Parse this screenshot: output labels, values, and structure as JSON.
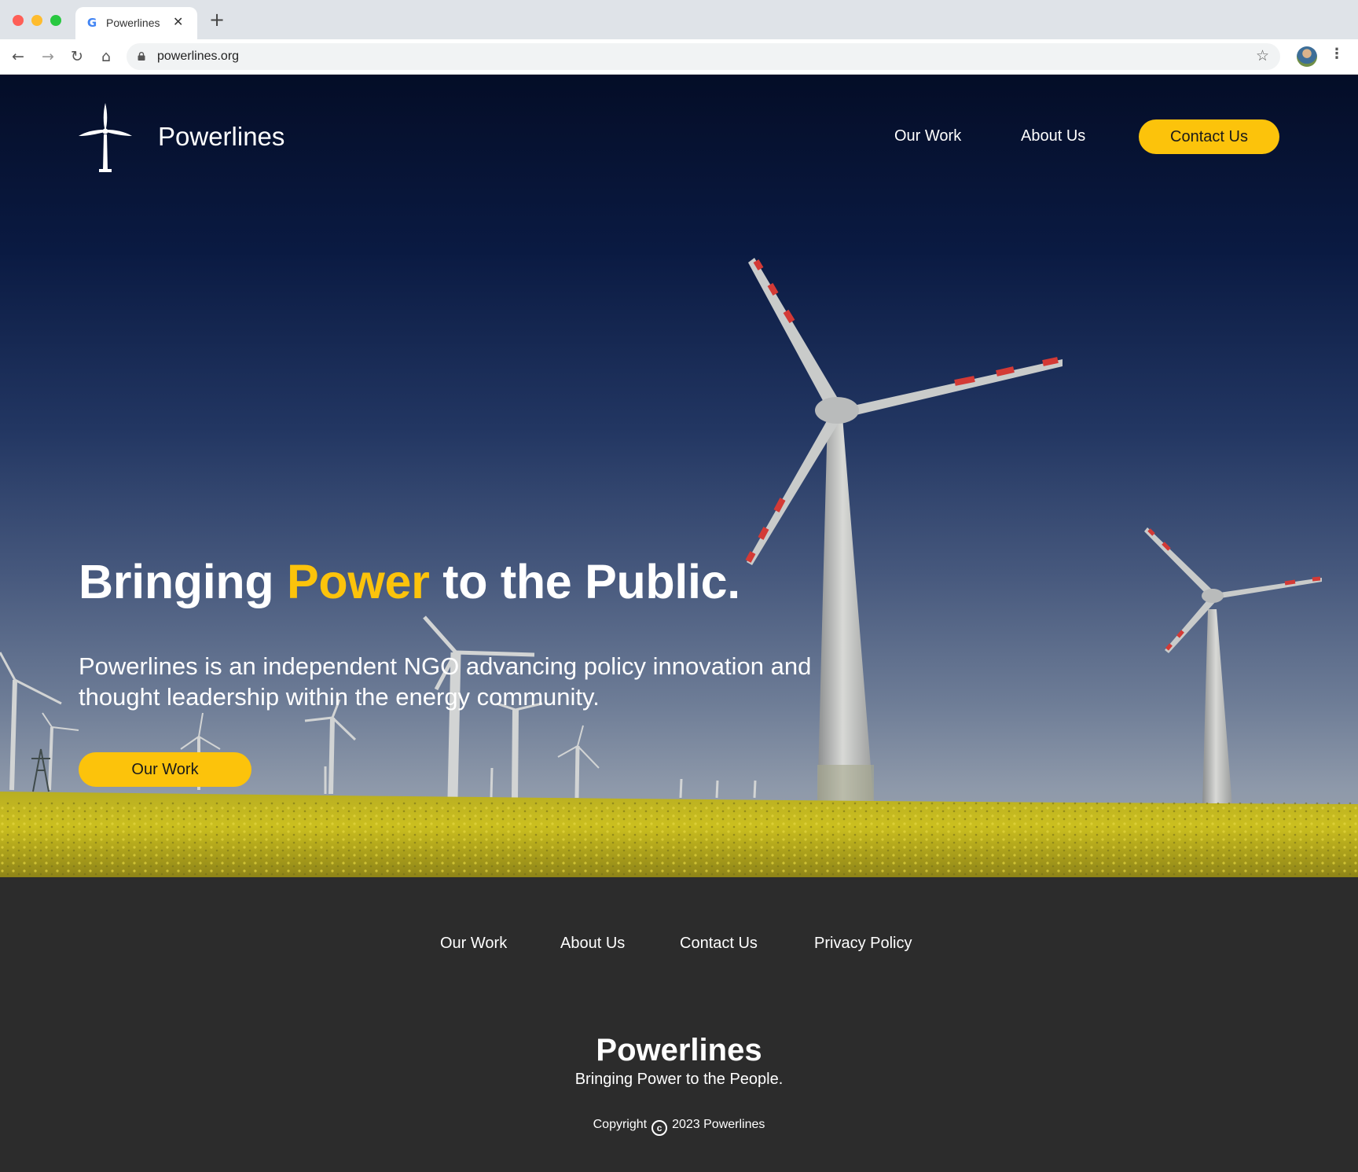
{
  "browser": {
    "tab_title": "Powerlines",
    "tab_favicon": "google-favicon",
    "new_tab_symbol": "+",
    "close_symbol": "✕",
    "url": "powerlines.org",
    "icons": [
      "back-arrow-icon",
      "forward-arrow-icon",
      "reload-icon",
      "home-icon",
      "lock-icon",
      "star-icon",
      "profile-avatar",
      "kebab-menu-icon"
    ]
  },
  "header": {
    "logo_text": "Powerlines",
    "logo_icon": "wind-turbine-icon",
    "nav": {
      "our_work": "Our Work",
      "about_us": "About Us",
      "contact_us": "Contact Us"
    }
  },
  "hero": {
    "headline_pre": "Bringing ",
    "headline_accent": "Power",
    "headline_post": " to the Public.",
    "subtext": "Powerlines is an independent NGO advancing policy innovation and thought leadership within the energy community.",
    "cta_label": "Our Work",
    "background": "wind-turbines-over-rapeseed-field"
  },
  "footer": {
    "links": [
      "Our Work",
      "About Us",
      "Contact Us",
      "Privacy Policy"
    ],
    "brand": "Powerlines",
    "tagline": "Bringing Power to the People.",
    "copyright_pre": "Copyright",
    "copyright_symbol": "c",
    "copyright_post": "2023 Powerlines"
  },
  "colors": {
    "accent": "#fcc30b",
    "footer_bg": "#2c2c2c",
    "sky_top": "#040d27",
    "field": "#c6bb1e"
  }
}
